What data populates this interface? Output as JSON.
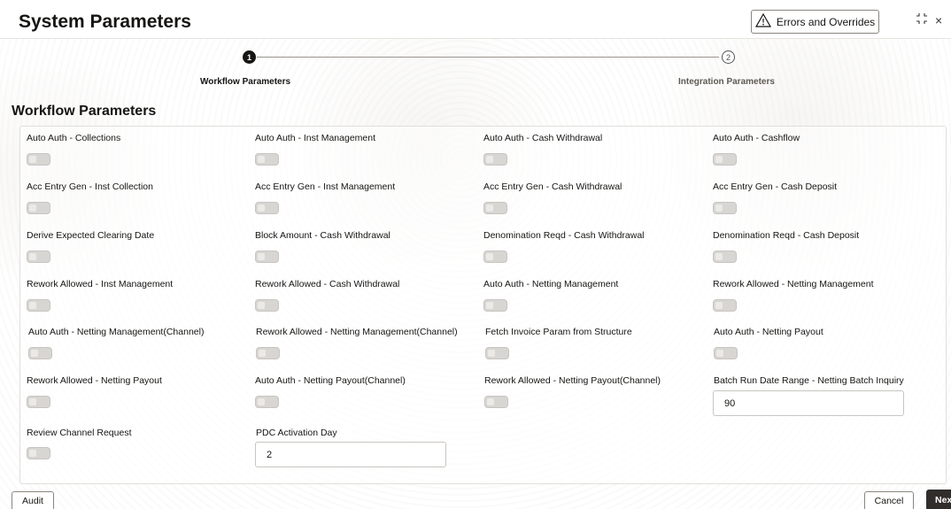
{
  "header": {
    "title": "System Parameters",
    "errors_button": "Errors and Overrides",
    "errors_icon": "warning-triangle-icon",
    "expand_icon": "collapse-icon",
    "close_icon": "close-icon",
    "close_glyph": "×"
  },
  "stepper": {
    "steps": [
      {
        "number": "1",
        "label": "Workflow Parameters",
        "active": true
      },
      {
        "number": "2",
        "label": "Integration Parameters",
        "active": false
      }
    ]
  },
  "section": {
    "title": "Workflow Parameters"
  },
  "fields": {
    "r1": [
      "Auto Auth - Collections",
      "Auto Auth - Inst Management",
      "Auto Auth - Cash Withdrawal",
      "Auto Auth - Cashflow"
    ],
    "r2": [
      "Acc Entry Gen - Inst Collection",
      "Acc Entry Gen - Inst Management",
      "Acc Entry Gen - Cash Withdrawal",
      "Acc Entry Gen - Cash Deposit"
    ],
    "r3": [
      "Derive Expected Clearing Date",
      "Block Amount - Cash Withdrawal",
      "Denomination Reqd - Cash Withdrawal",
      "Denomination Reqd - Cash Deposit"
    ],
    "r4": [
      "Rework Allowed - Inst Management",
      "Rework Allowed - Cash Withdrawal",
      "Auto Auth - Netting Management",
      "Rework Allowed - Netting Management"
    ],
    "r5": [
      "Auto Auth - Netting Management(Channel)",
      "Rework Allowed - Netting Management(Channel)",
      "Fetch Invoice Param from Structure",
      "Auto Auth - Netting Payout"
    ],
    "r6": [
      "Rework Allowed - Netting Payout",
      "Auto Auth - Netting Payout(Channel)",
      "Rework Allowed - Netting Payout(Channel)",
      "Batch Run Date Range - Netting Batch Inquiry"
    ],
    "r7": [
      "Review Channel Request",
      "PDC Activation Day"
    ]
  },
  "values": {
    "batch_run_date_range": "90",
    "pdc_activation_day": "2"
  },
  "toggles_state": "off",
  "footer": {
    "audit": "Audit",
    "cancel": "Cancel",
    "next": "Next"
  }
}
